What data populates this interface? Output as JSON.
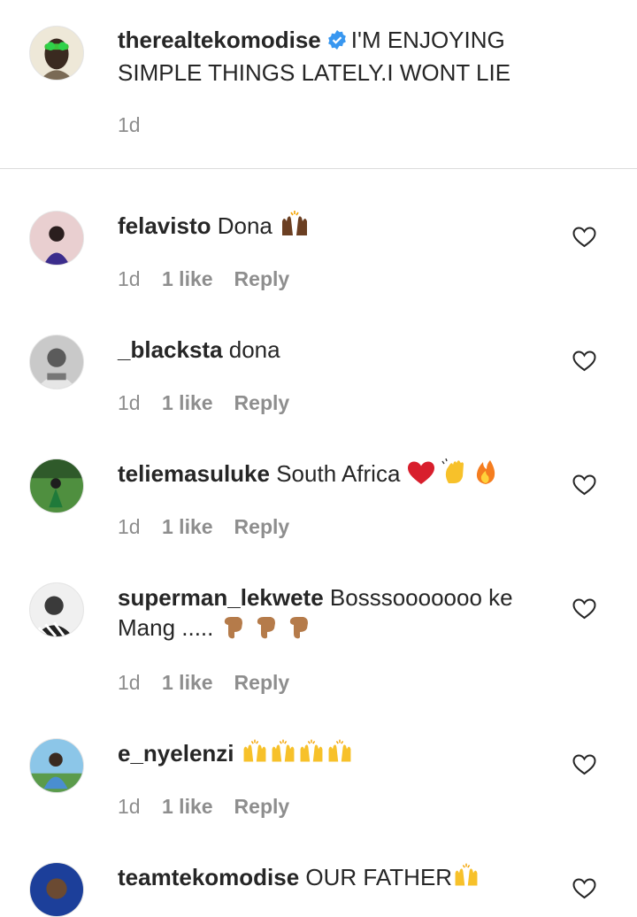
{
  "caption": {
    "username": "therealtekomodise",
    "text": "I'M ENJOYING SIMPLE THINGS LATELY.I WONT LIE",
    "time": "1d",
    "verified": true
  },
  "comments": [
    {
      "username": "felavisto",
      "text": "Dona",
      "emojis": [
        "raised-hands-dark"
      ],
      "time": "1d",
      "likes": "1 like",
      "reply": "Reply"
    },
    {
      "username": "_blacksta",
      "text": "dona",
      "emojis": [],
      "time": "1d",
      "likes": "1 like",
      "reply": "Reply"
    },
    {
      "username": "teliemasuluke",
      "text": "South Africa",
      "emojis": [
        "red-heart",
        "waving-hand",
        "fire"
      ],
      "time": "1d",
      "likes": "1 like",
      "reply": "Reply"
    },
    {
      "username": "superman_lekwete",
      "text": "Bosssooooooo ke Mang .....",
      "emojis": [
        "pointing-down-medium",
        "pointing-down-medium",
        "pointing-down-medium"
      ],
      "time": "1d",
      "likes": "1 like",
      "reply": "Reply"
    },
    {
      "username": "e_nyelenzi",
      "text": "",
      "emojis": [
        "raised-hands",
        "raised-hands",
        "raised-hands",
        "raised-hands"
      ],
      "time": "1d",
      "likes": "1 like",
      "reply": "Reply"
    },
    {
      "username": "teamtekomodise",
      "text": "OUR FATHER",
      "emojis": [
        "raised-hands"
      ]
    }
  ],
  "colors": {
    "text": "#262626",
    "muted": "#8e8e8e",
    "divider": "#dbdbdb",
    "verified": "#3897f0"
  }
}
